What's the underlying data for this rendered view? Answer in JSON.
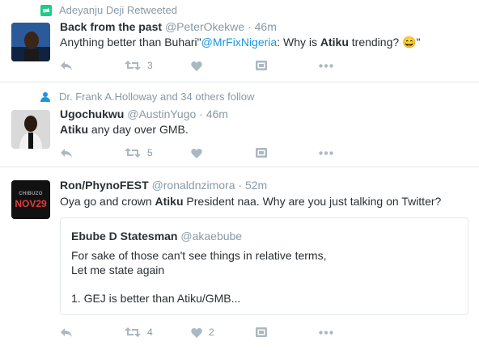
{
  "tweets": [
    {
      "context": "Adeyanju Deji Retweeted",
      "name": "Back from the past",
      "handle": "@PeterOkekwe",
      "sep": "·",
      "time": "46m",
      "text_a": "Anything better than Buhari\"",
      "mention": "@MrFixNigeria",
      "text_b": ": Why is ",
      "bold": "Atiku",
      "text_c": " trending? ",
      "emoji": "😄",
      "text_d": "\"",
      "retweets": "3",
      "likes": ""
    },
    {
      "context": "Dr. Frank A.Holloway and 34 others follow",
      "name": "Ugochukwu",
      "handle": "@AustinYugo",
      "sep": "·",
      "time": "46m",
      "bold": "Atiku",
      "text_a": " any day over GMB.",
      "retweets": "5",
      "likes": ""
    },
    {
      "name": "Ron/PhynoFEST",
      "handle": "@ronaldnzimora",
      "sep": "·",
      "time": "52m",
      "text_a": "Oya go and crown ",
      "bold": "Atiku",
      "text_b": " President naa. Why are you just talking on Twitter?",
      "retweets": "4",
      "likes": "2",
      "avatar_top": "CHIBUZO",
      "avatar_bottom": "NOV29",
      "quote": {
        "name": "Ebube D Statesman",
        "handle": "@akaebube",
        "line1": "For sake of those can't see things in relative terms,",
        "line2": "Let me state again",
        "line3": "1. GEJ is better than Atiku/GMB..."
      }
    }
  ],
  "colors": {
    "link": "#1b95e0",
    "muted": "#8899a6",
    "icon": "#aab8c2",
    "retweet": "#19cf86"
  },
  "icons": [
    "retweet-context-icon",
    "follow-context-icon",
    "reply-icon",
    "retweet-icon",
    "like-icon",
    "dm-icon",
    "more-icon"
  ]
}
